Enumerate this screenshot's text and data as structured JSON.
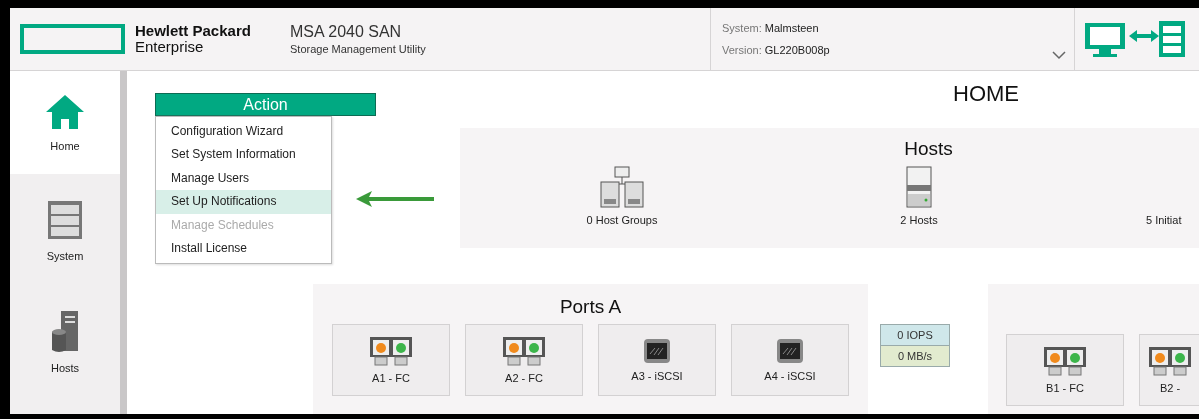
{
  "header": {
    "brand_line1": "Hewlett Packard",
    "brand_line2": "Enterprise",
    "product": "MSA 2040 SAN",
    "subtitle": "Storage Management Utility",
    "system_label": "System:",
    "system_value": "Malmsteen",
    "version_label": "Version:",
    "version_value": "GL220B008p"
  },
  "sidebar": {
    "items": [
      {
        "label": "Home",
        "kind": "home",
        "selected": true
      },
      {
        "label": "System",
        "kind": "system",
        "selected": false
      },
      {
        "label": "Hosts",
        "kind": "hosts",
        "selected": false
      }
    ]
  },
  "action_menu": {
    "title": "Action",
    "items": [
      {
        "label": "Configuration Wizard",
        "selected": false,
        "disabled": false
      },
      {
        "label": "Set System Information",
        "selected": false,
        "disabled": false
      },
      {
        "label": "Manage Users",
        "selected": false,
        "disabled": false
      },
      {
        "label": "Set Up Notifications",
        "selected": true,
        "disabled": false
      },
      {
        "label": "Manage Schedules",
        "selected": false,
        "disabled": true
      },
      {
        "label": "Install License",
        "selected": false,
        "disabled": false
      }
    ]
  },
  "page_title": "HOME",
  "hosts_panel": {
    "title": "Hosts",
    "items": [
      {
        "label": "0 Host Groups",
        "kind": "group"
      },
      {
        "label": "2 Hosts",
        "kind": "host"
      },
      {
        "label": "5 Initiat",
        "kind": "initiator"
      }
    ]
  },
  "ports_a": {
    "title": "Ports A",
    "ports": [
      {
        "label": "A1 - FC",
        "kind": "fc"
      },
      {
        "label": "A2 - FC",
        "kind": "fc"
      },
      {
        "label": "A3 - iSCSI",
        "kind": "iscsi"
      },
      {
        "label": "A4 - iSCSI",
        "kind": "iscsi"
      }
    ]
  },
  "throughput": {
    "iops": "0 IOPS",
    "rate": "0 MB/s"
  },
  "ports_b": {
    "ports": [
      {
        "label": "B1 - FC",
        "kind": "fc"
      },
      {
        "label": "B2 -",
        "kind": "fc"
      }
    ]
  }
}
